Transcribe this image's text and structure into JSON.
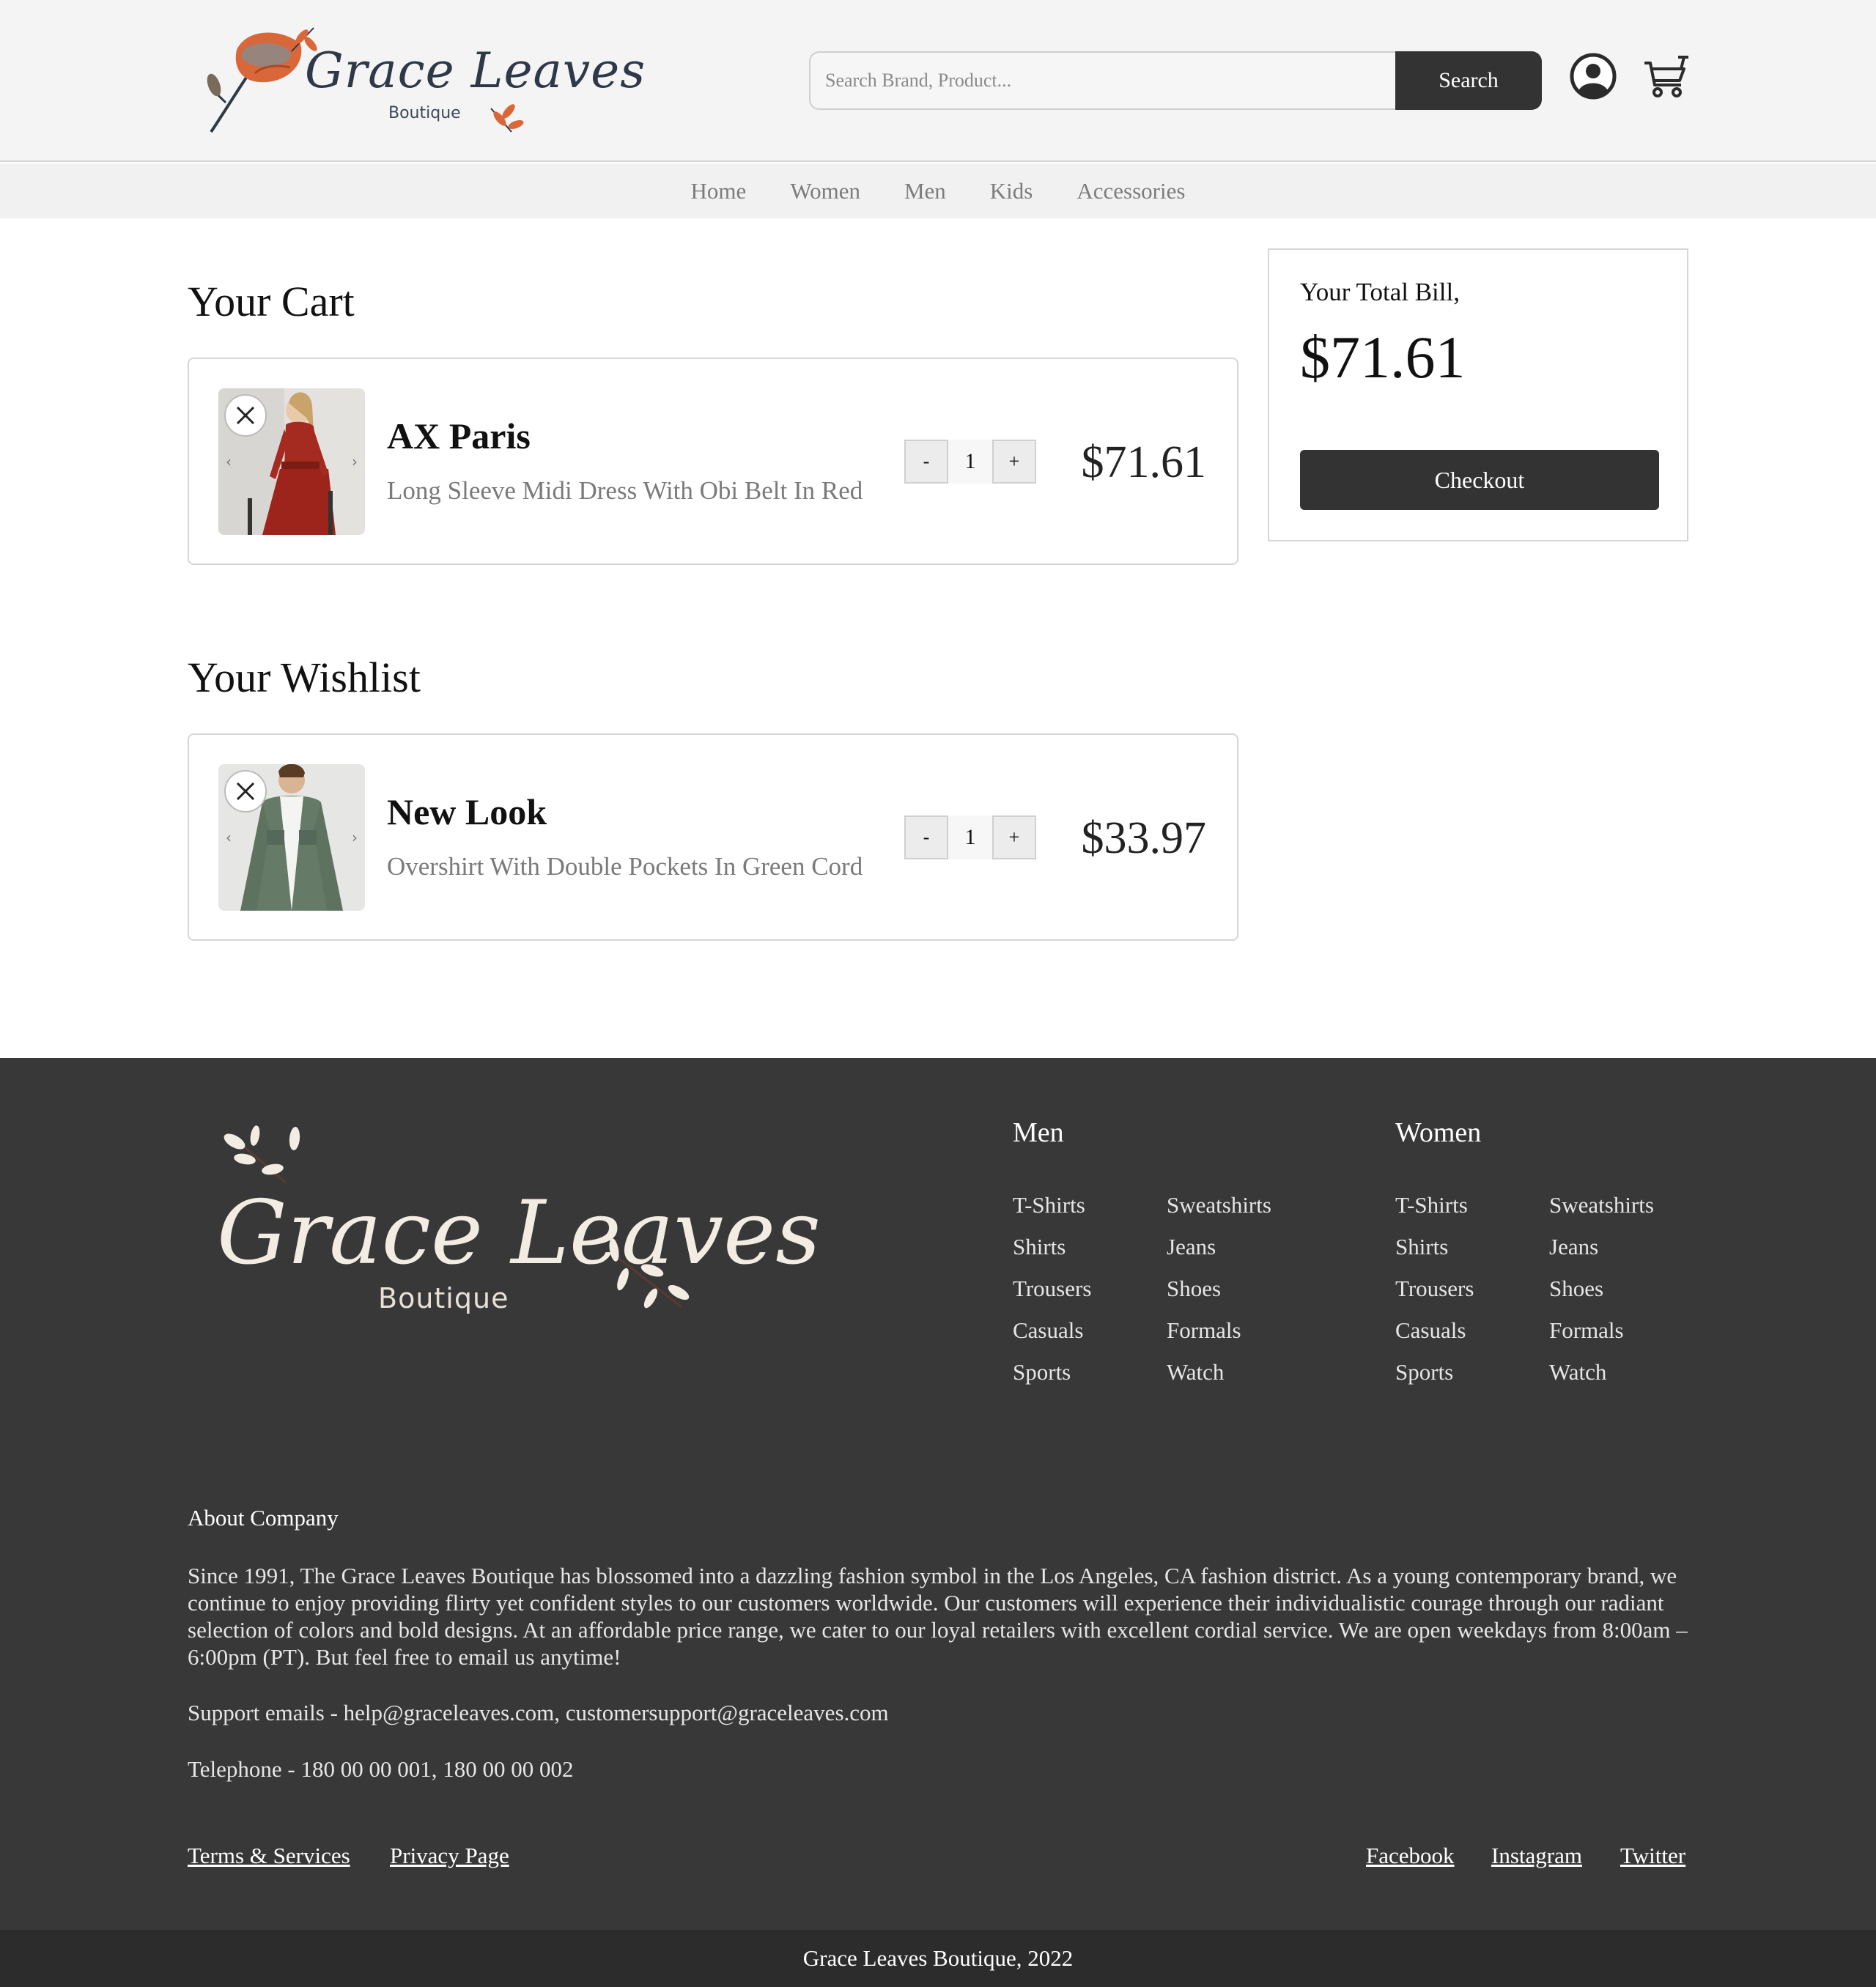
{
  "header": {
    "logo_title": "Grace Leaves",
    "logo_subtitle": "Boutique",
    "search_placeholder": "Search Brand, Product...",
    "search_button": "Search",
    "account_icon": "account-icon",
    "cart_icon": "cart-icon"
  },
  "nav": {
    "items": [
      "Home",
      "Women",
      "Men",
      "Kids",
      "Accessories"
    ]
  },
  "cart": {
    "title": "Your Cart",
    "items": [
      {
        "brand": "AX Paris",
        "description": "Long Sleeve Midi Dress With Obi Belt In Red",
        "quantity": "1",
        "price": "$71.61",
        "minus": "-",
        "plus": "+"
      }
    ]
  },
  "wishlist": {
    "title": "Your Wishlist",
    "items": [
      {
        "brand": "New Look",
        "description": "Overshirt With Double Pockets In Green Cord",
        "quantity": "1",
        "price": "$33.97",
        "minus": "-",
        "plus": "+"
      }
    ]
  },
  "bill": {
    "label": "Your Total Bill,",
    "total": "$71.61",
    "checkout": "Checkout"
  },
  "footer": {
    "logo_title": "Grace Leaves",
    "logo_subtitle": "Boutique",
    "men": {
      "title": "Men",
      "col1": [
        "T-Shirts",
        "Shirts",
        "Trousers",
        "Casuals",
        "Sports"
      ],
      "col2": [
        "Sweatshirts",
        "Jeans",
        "Shoes",
        "Formals",
        "Watch"
      ]
    },
    "women": {
      "title": "Women",
      "col1": [
        "T-Shirts",
        "Shirts",
        "Trousers",
        "Casuals",
        "Sports"
      ],
      "col2": [
        "Sweatshirts",
        "Jeans",
        "Shoes",
        "Formals",
        "Watch"
      ]
    },
    "about_title": "About Company",
    "about_text": "Since 1991, The Grace Leaves Boutique has blossomed into a dazzling fashion symbol in the Los Angeles, CA fashion district. As a young contemporary brand, we continue to enjoy providing flirty yet confident styles to our customers worldwide. Our customers will experience their individualistic courage through our radiant selection of colors and bold designs. At an affordable price range, we cater to our loyal retailers with excellent cordial service. We are open weekdays from 8:00am – 6:00pm (PT). But feel free to email us anytime!",
    "support": "Support emails - help@graceleaves.com, customersupport@graceleaves.com",
    "telephone": "Telephone - 180 00 00 001, 180 00 00 002",
    "links_left": [
      "Terms & Services",
      "Privacy Page"
    ],
    "links_right": [
      "Facebook",
      "Instagram",
      "Twitter"
    ],
    "copyright": "Grace Leaves Boutique, 2022"
  },
  "colors": {
    "header_bg": "#f4f4f4",
    "dark_button": "#333333",
    "footer_bg": "#383838",
    "logo_orange": "#d9673a",
    "logo_navy": "#2e3848"
  }
}
